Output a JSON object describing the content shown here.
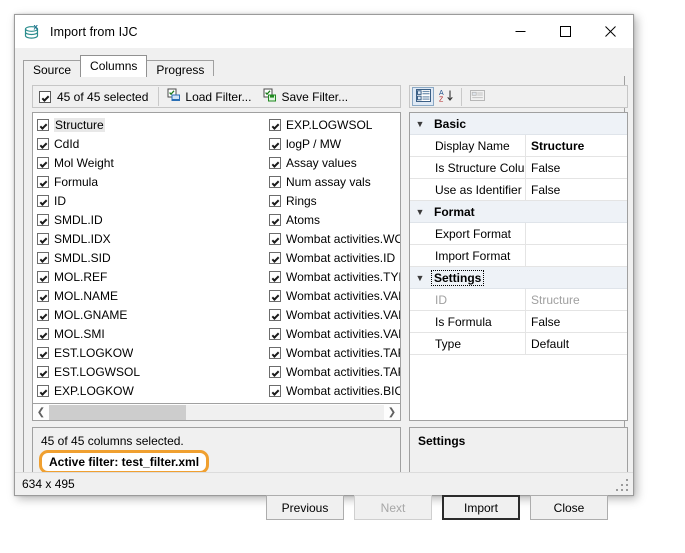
{
  "window": {
    "title": "Import from IJC",
    "icon": "database-x-icon",
    "controls": {
      "minimize": "minimize-icon",
      "maximize": "maximize-icon",
      "close": "close-icon"
    },
    "status_bar": "634 x 495"
  },
  "tabs": [
    {
      "label": "Source",
      "active": false
    },
    {
      "label": "Columns",
      "active": true
    },
    {
      "label": "Progress",
      "active": false
    }
  ],
  "left_toolbar": {
    "select_all_label": "45 of 45 selected",
    "select_all_checked": true,
    "load_filter_label": "Load Filter...",
    "load_filter_icon": "load-filter-icon",
    "save_filter_label": "Save Filter...",
    "save_filter_icon": "save-filter-icon"
  },
  "columns_list": {
    "left": [
      {
        "label": "Structure",
        "checked": true,
        "selected": true
      },
      {
        "label": "CdId",
        "checked": true,
        "selected": false
      },
      {
        "label": "Mol Weight",
        "checked": true,
        "selected": false
      },
      {
        "label": "Formula",
        "checked": true,
        "selected": false
      },
      {
        "label": "ID",
        "checked": true,
        "selected": false
      },
      {
        "label": "SMDL.ID",
        "checked": true,
        "selected": false
      },
      {
        "label": "SMDL.IDX",
        "checked": true,
        "selected": false
      },
      {
        "label": "SMDL.SID",
        "checked": true,
        "selected": false
      },
      {
        "label": "MOL.REF",
        "checked": true,
        "selected": false
      },
      {
        "label": "MOL.NAME",
        "checked": true,
        "selected": false
      },
      {
        "label": "MOL.GNAME",
        "checked": true,
        "selected": false
      },
      {
        "label": "MOL.SMI",
        "checked": true,
        "selected": false
      },
      {
        "label": "EST.LOGKOW",
        "checked": true,
        "selected": false
      },
      {
        "label": "EST.LOGWSOL",
        "checked": true,
        "selected": false
      },
      {
        "label": "EXP.LOGKOW",
        "checked": true,
        "selected": false
      }
    ],
    "right": [
      {
        "label": "EXP.LOGWSOL",
        "checked": true
      },
      {
        "label": "logP / MW",
        "checked": true
      },
      {
        "label": "Assay values",
        "checked": true
      },
      {
        "label": "Num assay vals",
        "checked": true
      },
      {
        "label": "Rings",
        "checked": true
      },
      {
        "label": "Atoms",
        "checked": true
      },
      {
        "label": "Wombat activities.WOM",
        "checked": true
      },
      {
        "label": "Wombat activities.ID",
        "checked": true
      },
      {
        "label": "Wombat activities.TYPE",
        "checked": true
      },
      {
        "label": "Wombat activities.VALUE",
        "checked": true
      },
      {
        "label": "Wombat activities.VALUE",
        "checked": true
      },
      {
        "label": "Wombat activities.VALUE",
        "checked": true
      },
      {
        "label": "Wombat activities.TARG",
        "checked": true
      },
      {
        "label": "Wombat activities.TARG",
        "checked": true
      },
      {
        "label": "Wombat activities.BIO.S",
        "checked": true
      }
    ]
  },
  "scrollbar": {
    "left_arrow": "chevron-left-icon",
    "right_arrow": "chevron-right-icon"
  },
  "status_panel": {
    "selection_text": "45 of 45 columns selected.",
    "active_filter_text": "Active filter: test_filter.xml",
    "highlight_color": "#f0a030"
  },
  "property_toolbar": {
    "categorized_icon": "categorized-view-icon",
    "alphabetical_icon": "sort-alphabetical-icon",
    "description_icon": "description-pane-icon"
  },
  "properties": [
    {
      "category": "Basic",
      "focused": false,
      "rows": [
        {
          "name": "Display Name",
          "value": "Structure",
          "bold": true,
          "dim": false
        },
        {
          "name": "Is Structure Colu",
          "value": "False",
          "bold": false,
          "dim": false
        },
        {
          "name": "Use as Identifier",
          "value": "False",
          "bold": false,
          "dim": false
        }
      ]
    },
    {
      "category": "Format",
      "focused": false,
      "rows": [
        {
          "name": "Export Format",
          "value": "",
          "bold": false,
          "dim": false
        },
        {
          "name": "Import Format",
          "value": "",
          "bold": false,
          "dim": false
        }
      ]
    },
    {
      "category": "Settings",
      "focused": true,
      "rows": [
        {
          "name": "ID",
          "value": "Structure",
          "bold": false,
          "dim": true
        },
        {
          "name": "Is Formula",
          "value": "False",
          "bold": false,
          "dim": false
        },
        {
          "name": "Type",
          "value": "Default",
          "bold": false,
          "dim": false
        }
      ]
    }
  ],
  "description_panel": {
    "title": "Settings"
  },
  "buttons": [
    {
      "label": "Previous",
      "state": "normal"
    },
    {
      "label": "Next",
      "state": "disabled"
    },
    {
      "label": "Import",
      "state": "default"
    },
    {
      "label": "Close",
      "state": "normal"
    }
  ]
}
